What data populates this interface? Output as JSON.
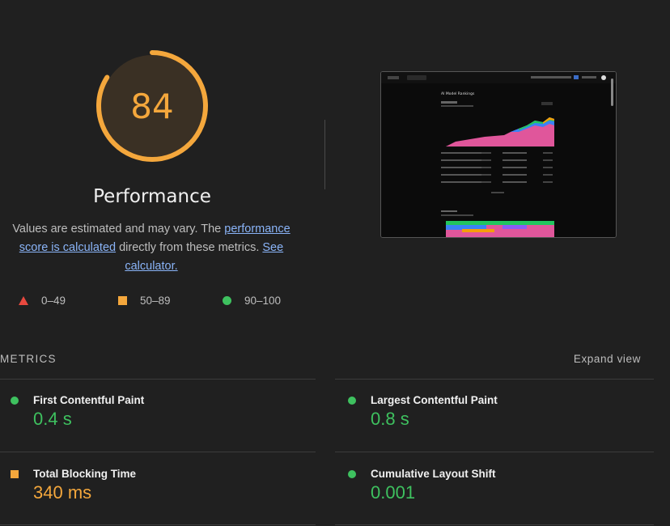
{
  "score": {
    "value": "84",
    "fraction": 0.84,
    "color": "#f4a73c",
    "title": "Performance"
  },
  "description": {
    "text1": "Values are estimated and may vary. The ",
    "link1": "performance score is calculated",
    "text2": " directly from these metrics. ",
    "link2": "See calculator."
  },
  "legend": [
    {
      "range": "0–49",
      "shape": "triangle",
      "color": "#e8493f"
    },
    {
      "range": "50–89",
      "shape": "square",
      "color": "#f4a73c"
    },
    {
      "range": "90–100",
      "shape": "circle",
      "color": "#3ec15f"
    }
  ],
  "screenshot": {
    "page_title": "AI Model Rankings"
  },
  "metrics": {
    "title": "METRICS",
    "expand_label": "Expand view",
    "items": [
      {
        "label": "First Contentful Paint",
        "value": "0.4 s",
        "status": "good",
        "color": "#3ec15f"
      },
      {
        "label": "Largest Contentful Paint",
        "value": "0.8 s",
        "status": "good",
        "color": "#3ec15f"
      },
      {
        "label": "Total Blocking Time",
        "value": "340 ms",
        "status": "average",
        "color": "#f4a73c"
      },
      {
        "label": "Cumulative Layout Shift",
        "value": "0.001",
        "status": "good",
        "color": "#3ec15f"
      }
    ]
  }
}
